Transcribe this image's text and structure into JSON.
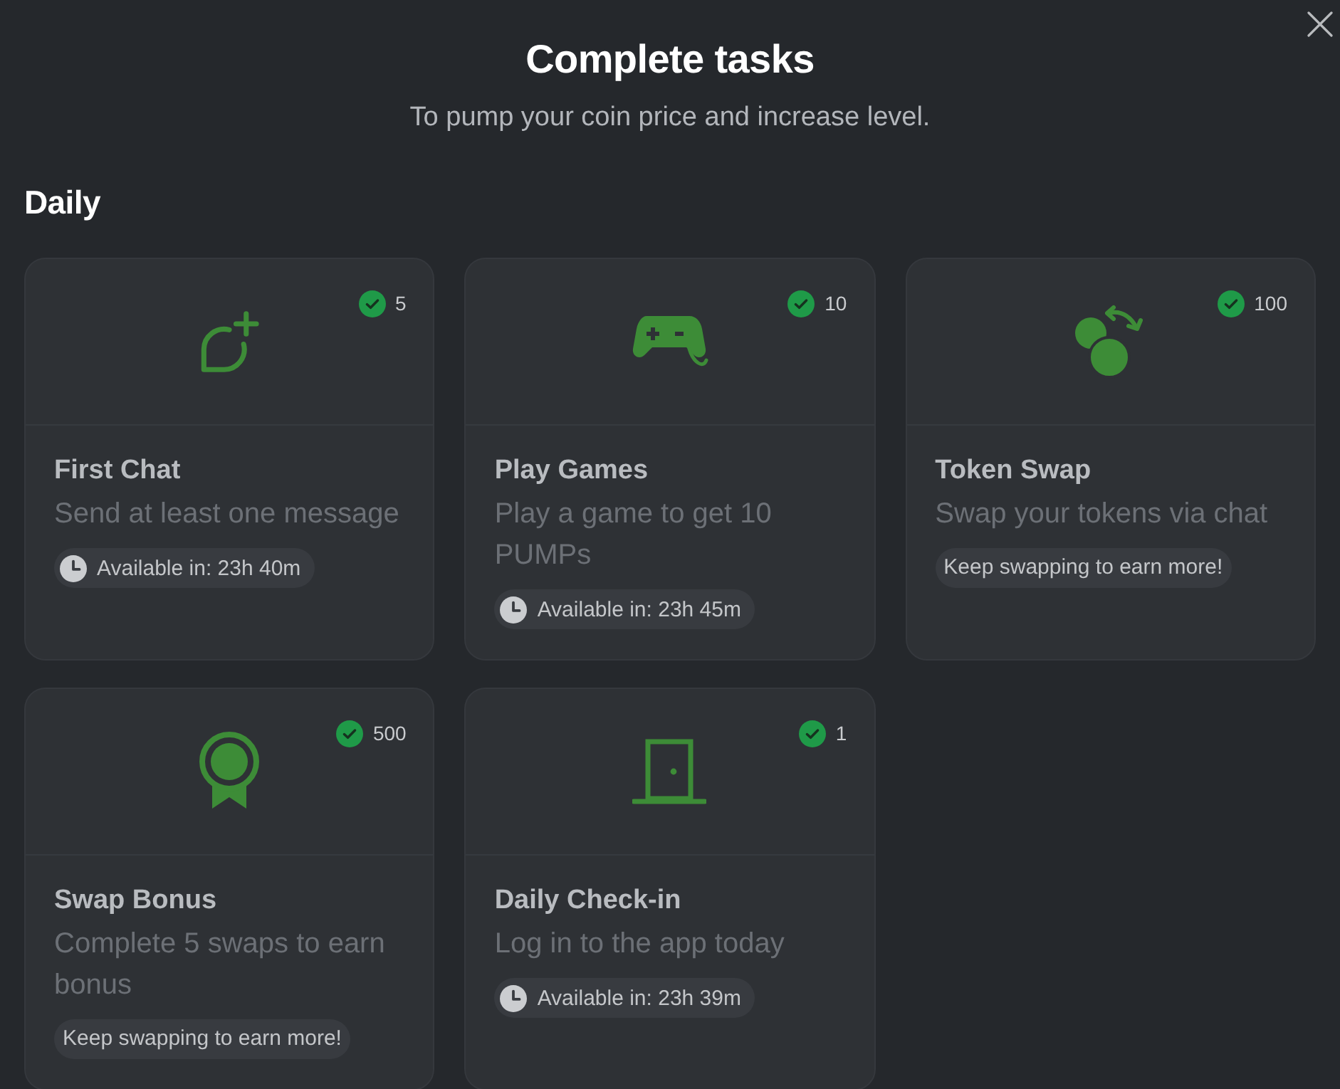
{
  "dialog": {
    "title": "Complete tasks",
    "subtitle": "To pump your coin price and increase level."
  },
  "section": {
    "title": "Daily"
  },
  "tasks": [
    {
      "reward": "5",
      "completed": true,
      "title": "First Chat",
      "description": "Send at least one message",
      "footer": {
        "kind": "timer",
        "text": "Available in: 23h 40m"
      }
    },
    {
      "reward": "10",
      "completed": true,
      "title": "Play Games",
      "description": "Play a game to get 10 PUMPs",
      "footer": {
        "kind": "timer",
        "text": "Available in: 23h 45m"
      }
    },
    {
      "reward": "100",
      "completed": true,
      "title": "Token Swap",
      "description": "Swap your tokens via chat",
      "footer": {
        "kind": "note",
        "text": "Keep swapping to earn more!"
      }
    },
    {
      "reward": "500",
      "completed": true,
      "title": "Swap Bonus",
      "description": "Complete 5 swaps to earn bonus",
      "footer": {
        "kind": "note",
        "text": "Keep swapping to earn more!"
      }
    },
    {
      "reward": "1",
      "completed": true,
      "title": "Daily Check-in",
      "description": "Log in to the app today",
      "footer": {
        "kind": "timer",
        "text": "Available in: 23h 39m"
      }
    }
  ]
}
